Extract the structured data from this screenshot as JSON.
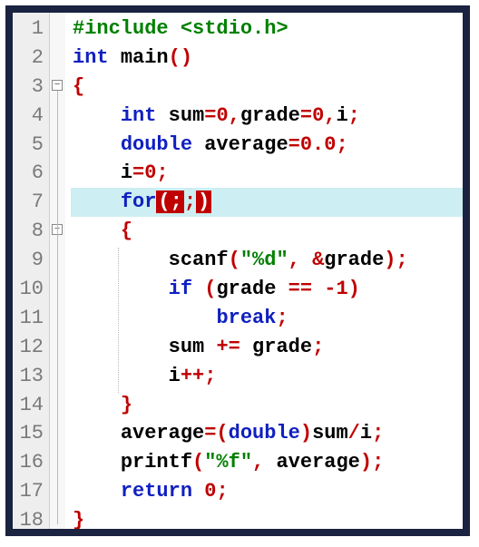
{
  "language": "c",
  "highlighted_line": 7,
  "fold_markers": [
    {
      "line": 3,
      "symbol": "−"
    },
    {
      "line": 8,
      "symbol": "−"
    }
  ],
  "lines": [
    {
      "n": 1,
      "indent": 0,
      "tokens": [
        [
          "pp",
          "#include"
        ],
        [
          "pun",
          " "
        ],
        [
          "pp",
          "<stdio.h>"
        ]
      ]
    },
    {
      "n": 2,
      "indent": 0,
      "tokens": [
        [
          "kw",
          "int"
        ],
        [
          "pun",
          " "
        ],
        [
          "fn",
          "main"
        ],
        [
          "op",
          "()"
        ]
      ]
    },
    {
      "n": 3,
      "indent": 0,
      "tokens": [
        [
          "op",
          "{"
        ]
      ]
    },
    {
      "n": 4,
      "indent": 1,
      "tokens": [
        [
          "kw",
          "int"
        ],
        [
          "pun",
          " sum"
        ],
        [
          "op",
          "="
        ],
        [
          "num",
          "0"
        ],
        [
          "op",
          ","
        ],
        [
          "pun",
          "grade"
        ],
        [
          "op",
          "="
        ],
        [
          "num",
          "0"
        ],
        [
          "op",
          ","
        ],
        [
          "pun",
          "i"
        ],
        [
          "op",
          ";"
        ]
      ]
    },
    {
      "n": 5,
      "indent": 1,
      "tokens": [
        [
          "kw",
          "double"
        ],
        [
          "pun",
          " average"
        ],
        [
          "op",
          "="
        ],
        [
          "num",
          "0.0"
        ],
        [
          "op",
          ";"
        ]
      ]
    },
    {
      "n": 6,
      "indent": 1,
      "tokens": [
        [
          "pun",
          "i"
        ],
        [
          "op",
          "="
        ],
        [
          "num",
          "0"
        ],
        [
          "op",
          ";"
        ]
      ]
    },
    {
      "n": 7,
      "indent": 1,
      "tokens": [
        [
          "kw",
          "for"
        ],
        [
          "sel",
          "(;"
        ],
        [
          "op",
          ";"
        ],
        [
          "sel",
          ")"
        ]
      ]
    },
    {
      "n": 8,
      "indent": 1,
      "tokens": [
        [
          "op",
          "{"
        ]
      ]
    },
    {
      "n": 9,
      "indent": 2,
      "tokens": [
        [
          "pun",
          "scanf"
        ],
        [
          "op",
          "("
        ],
        [
          "str",
          "\"%d\""
        ],
        [
          "op",
          ","
        ],
        [
          "pun",
          " "
        ],
        [
          "op",
          "&"
        ],
        [
          "pun",
          "grade"
        ],
        [
          "op",
          ");"
        ]
      ]
    },
    {
      "n": 10,
      "indent": 2,
      "tokens": [
        [
          "kw",
          "if"
        ],
        [
          "pun",
          " "
        ],
        [
          "op",
          "("
        ],
        [
          "pun",
          "grade "
        ],
        [
          "op",
          "=="
        ],
        [
          "pun",
          " "
        ],
        [
          "op",
          "-"
        ],
        [
          "num",
          "1"
        ],
        [
          "op",
          ")"
        ]
      ]
    },
    {
      "n": 11,
      "indent": 3,
      "tokens": [
        [
          "kw",
          "break"
        ],
        [
          "op",
          ";"
        ]
      ]
    },
    {
      "n": 12,
      "indent": 2,
      "tokens": [
        [
          "pun",
          "sum "
        ],
        [
          "op",
          "+="
        ],
        [
          "pun",
          " grade"
        ],
        [
          "op",
          ";"
        ]
      ]
    },
    {
      "n": 13,
      "indent": 2,
      "tokens": [
        [
          "pun",
          "i"
        ],
        [
          "op",
          "++;"
        ]
      ]
    },
    {
      "n": 14,
      "indent": 1,
      "tokens": [
        [
          "op",
          "}"
        ]
      ]
    },
    {
      "n": 15,
      "indent": 1,
      "tokens": [
        [
          "pun",
          "average"
        ],
        [
          "op",
          "=("
        ],
        [
          "kw",
          "double"
        ],
        [
          "op",
          ")"
        ],
        [
          "pun",
          "sum"
        ],
        [
          "op",
          "/"
        ],
        [
          "pun",
          "i"
        ],
        [
          "op",
          ";"
        ]
      ]
    },
    {
      "n": 16,
      "indent": 1,
      "tokens": [
        [
          "pun",
          "printf"
        ],
        [
          "op",
          "("
        ],
        [
          "str",
          "\"%f\""
        ],
        [
          "op",
          ","
        ],
        [
          "pun",
          " average"
        ],
        [
          "op",
          ");"
        ]
      ]
    },
    {
      "n": 17,
      "indent": 1,
      "tokens": [
        [
          "kw",
          "return"
        ],
        [
          "pun",
          " "
        ],
        [
          "num",
          "0"
        ],
        [
          "op",
          ";"
        ]
      ]
    },
    {
      "n": 18,
      "indent": 0,
      "tokens": [
        [
          "op",
          "}"
        ]
      ]
    }
  ],
  "indent_string": "    "
}
